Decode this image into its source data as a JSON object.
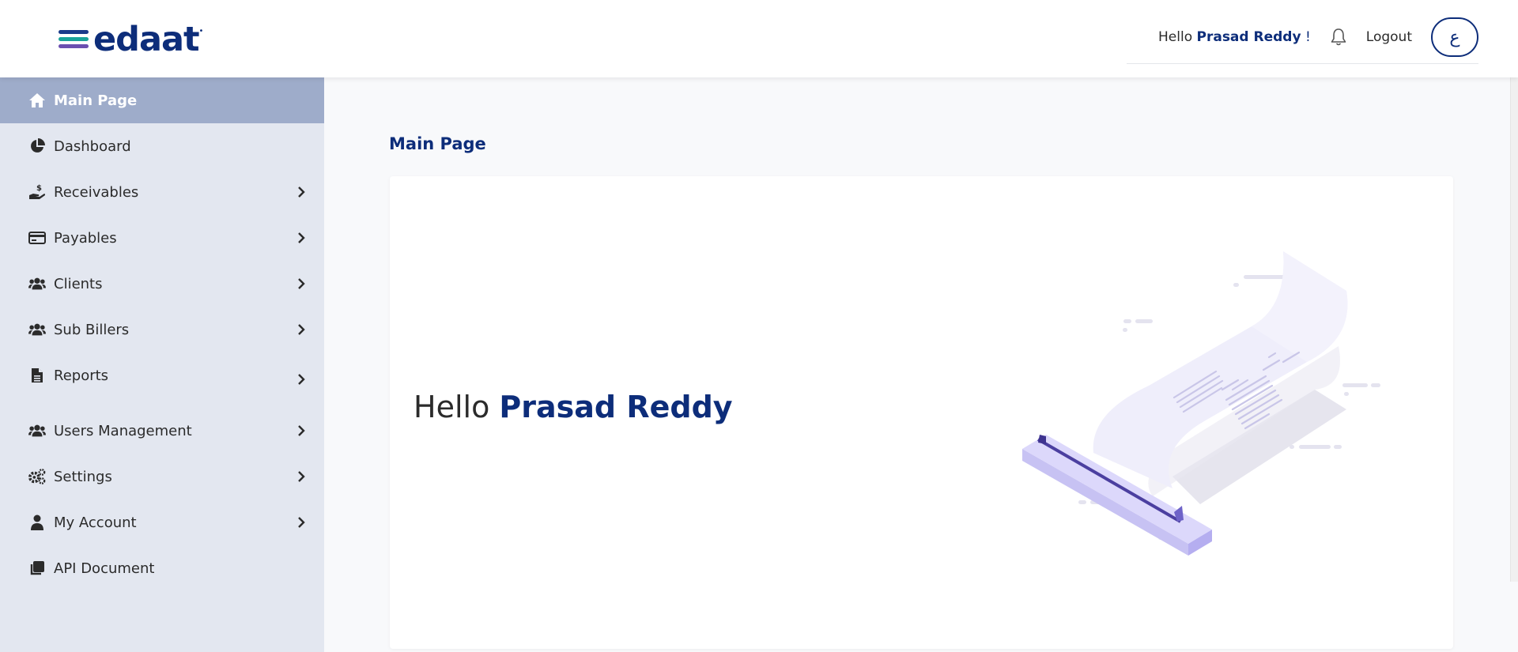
{
  "header": {
    "logo_text": "edaat",
    "greeting_prefix": "Hello",
    "user_name": "Prasad Reddy",
    "greeting_suffix": "!",
    "logout_label": "Logout",
    "language_button": "ع"
  },
  "sidebar": {
    "items": [
      {
        "label": "Main Page",
        "icon": "home-icon",
        "active": true
      },
      {
        "label": "Dashboard",
        "icon": "pie-chart-icon"
      },
      {
        "label": "Receivables",
        "icon": "hand-dollar-icon"
      },
      {
        "label": "Payables",
        "icon": "credit-card-icon"
      },
      {
        "label": "Clients",
        "icon": "users-icon"
      },
      {
        "label": "Sub Billers",
        "icon": "users-icon"
      },
      {
        "label": "Reports",
        "icon": "file-icon"
      },
      {
        "label": "Users Management",
        "icon": "users-icon"
      },
      {
        "label": "Settings",
        "icon": "gears-icon"
      },
      {
        "label": "My Account",
        "icon": "user-icon"
      },
      {
        "label": "API Document",
        "icon": "copy-icon"
      }
    ]
  },
  "main": {
    "title": "Main Page",
    "hello_prefix": "Hello",
    "hello_name": "Prasad Reddy"
  },
  "colors": {
    "brand": "#0d2d7a",
    "sidebar_bg": "#e3e7f0",
    "sidebar_active": "#9eacca"
  }
}
